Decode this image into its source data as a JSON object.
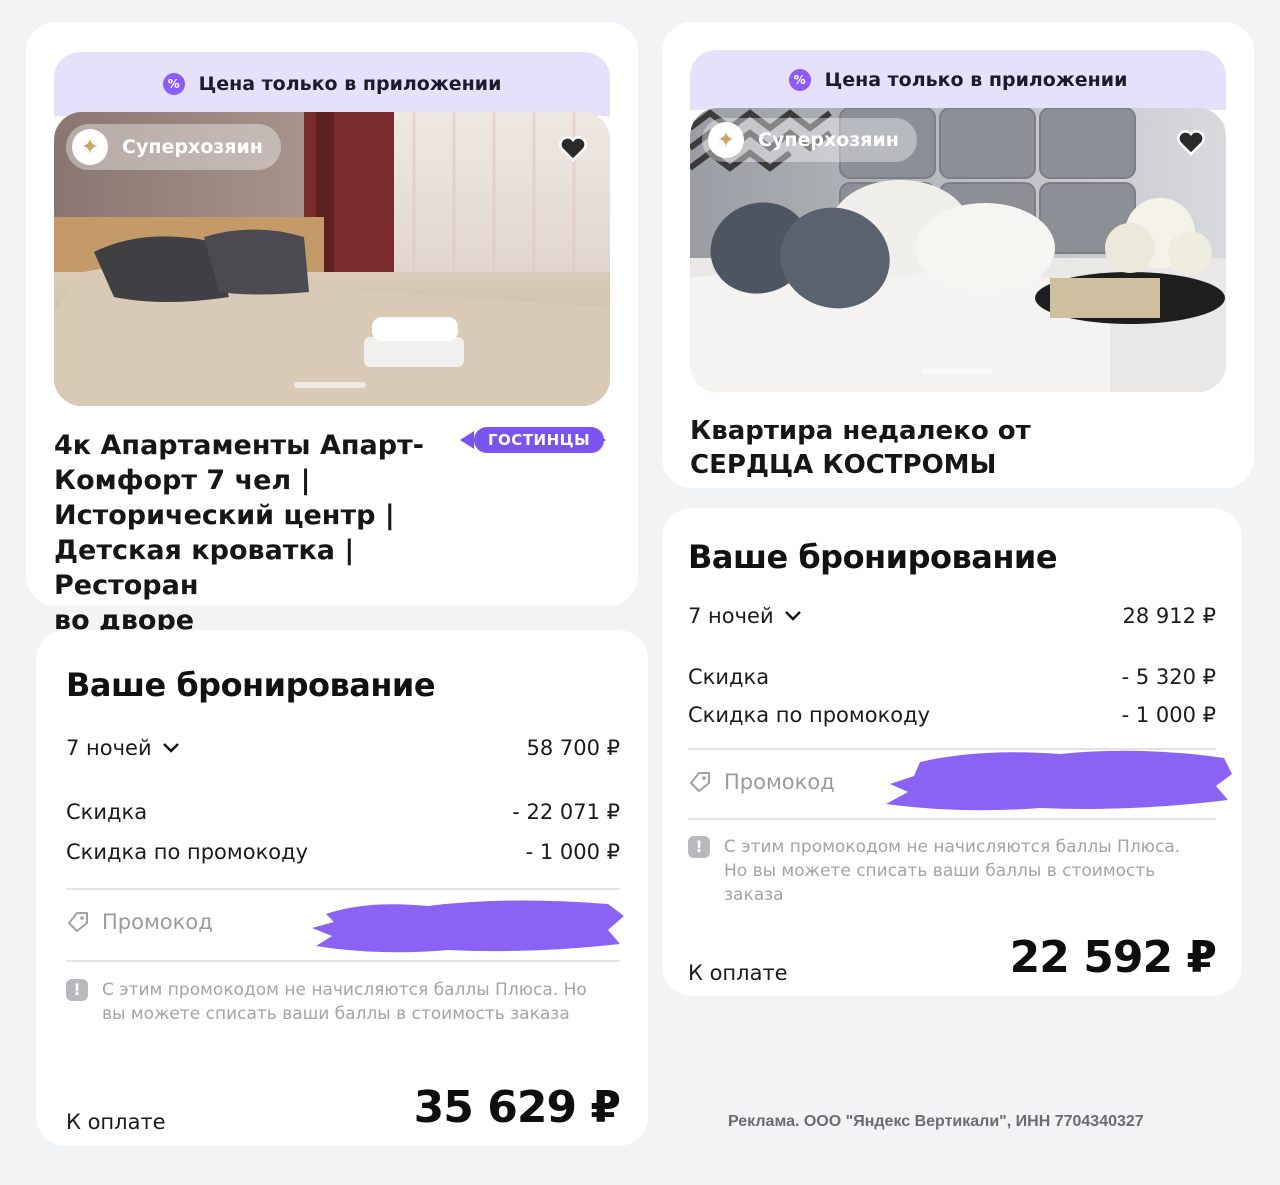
{
  "listings": [
    {
      "banner": "Цена только в приложении",
      "host_badge": "Суперхозяин",
      "title_lines": [
        "4к Апартаменты Апарт-",
        "Комфорт 7 чел |",
        "Исторический центр |",
        "Детская кроватка | Ресторан",
        "во дворе"
      ],
      "tag": "ГОСТИНЦЫ"
    },
    {
      "banner": "Цена только в приложении",
      "host_badge": "Суперхозяин",
      "title_lines": [
        "Квартира недалеко от",
        "СЕРДЦА КОСТРОМЫ"
      ]
    }
  ],
  "bookings": [
    {
      "heading": "Ваше бронирование",
      "nights_label": "7 ночей",
      "nights_price": "58 700 ₽",
      "discount_label": "Скидка",
      "discount_value": "- 22 071 ₽",
      "promo_discount_label": "Скидка по промокоду",
      "promo_discount_value": "- 1 000 ₽",
      "promo_placeholder": "Промокод",
      "note": "С этим промокодом не начисляются баллы Плюса. Но вы можете списать ваши баллы в стоимость заказа",
      "pay_label": "К оплате",
      "pay_total": "35 629 ₽"
    },
    {
      "heading": "Ваше бронирование",
      "nights_label": "7 ночей",
      "nights_price": "28 912 ₽",
      "discount_label": "Скидка",
      "discount_value": "- 5 320 ₽",
      "promo_discount_label": "Скидка по промокоду",
      "promo_discount_value": "- 1 000 ₽",
      "promo_placeholder": "Промокод",
      "note": "С этим промокодом не начисляются баллы Плюса. Но вы можете списать ваши баллы в стоимость заказа",
      "pay_label": "К оплате",
      "pay_total": "22 592 ₽"
    }
  ],
  "ad_disclaimer": "Реклама. ООО \"Яндекс Вертикали\", ИНН 7704340327",
  "colors": {
    "accent": "#7b54f0",
    "banner": "#e6e1fb",
    "scribble": "#8a63f5"
  },
  "icons": [
    "percent-icon",
    "star-badge-icon",
    "heart-icon",
    "chevron-down-icon",
    "tag-icon",
    "warning-icon"
  ]
}
